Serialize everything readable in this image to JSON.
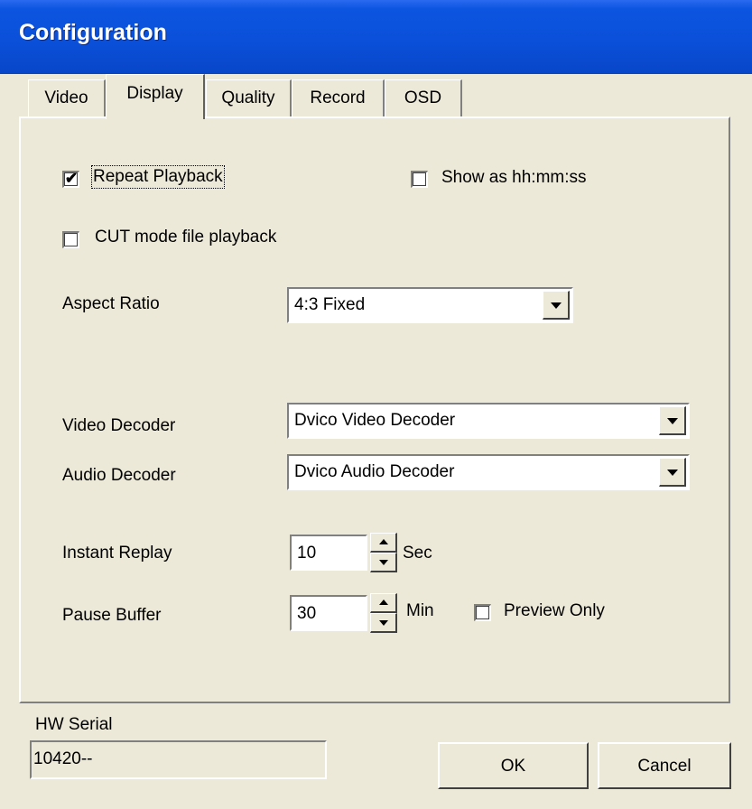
{
  "window": {
    "title": "Configuration"
  },
  "tabs": [
    {
      "label": "Video",
      "active": false
    },
    {
      "label": "Display",
      "active": true
    },
    {
      "label": "Quality",
      "active": false
    },
    {
      "label": "Record",
      "active": false
    },
    {
      "label": "OSD",
      "active": false
    }
  ],
  "display": {
    "repeat_playback": {
      "label": "Repeat Playback",
      "checked": true
    },
    "show_hhmmss": {
      "label": "Show as hh:mm:ss",
      "checked": false
    },
    "cut_mode": {
      "label": "CUT mode file playback",
      "checked": false
    },
    "aspect_ratio": {
      "label": "Aspect Ratio",
      "value": "4:3 Fixed"
    },
    "video_decoder": {
      "label": "Video Decoder",
      "value": "Dvico Video Decoder"
    },
    "audio_decoder": {
      "label": "Audio Decoder",
      "value": "Dvico Audio Decoder"
    },
    "instant_replay": {
      "label": "Instant Replay",
      "value": "10",
      "unit": "Sec"
    },
    "pause_buffer": {
      "label": "Pause Buffer",
      "value": "30",
      "unit": "Min"
    },
    "preview_only": {
      "label": "Preview Only",
      "checked": false
    }
  },
  "hw_serial": {
    "label": "HW Serial",
    "value": "10420--"
  },
  "buttons": {
    "ok": "OK",
    "cancel": "Cancel"
  },
  "colors": {
    "titlebar": "#0a4fd8",
    "face": "#ece9d8"
  },
  "icons": {
    "check": "✔"
  }
}
